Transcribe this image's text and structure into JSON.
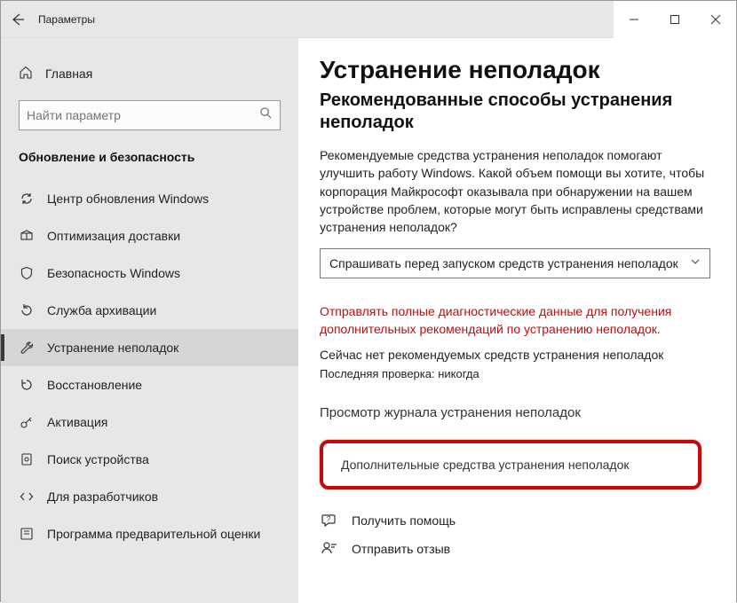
{
  "titlebar": {
    "title": "Параметры"
  },
  "sidebar": {
    "home": "Главная",
    "search_placeholder": "Найти параметр",
    "section": "Обновление и безопасность",
    "items": [
      {
        "label": "Центр обновления Windows"
      },
      {
        "label": "Оптимизация доставки"
      },
      {
        "label": "Безопасность Windows"
      },
      {
        "label": "Служба архивации"
      },
      {
        "label": "Устранение неполадок"
      },
      {
        "label": "Восстановление"
      },
      {
        "label": "Активация"
      },
      {
        "label": "Поиск устройства"
      },
      {
        "label": "Для разработчиков"
      },
      {
        "label": "Программа предварительной оценки"
      }
    ]
  },
  "main": {
    "h1": "Устранение неполадок",
    "h2": "Рекомендованные способы устранения неполадок",
    "para": "Рекомендуемые средства устранения неполадок помогают улучшить работу Windows. Какой объем помощи вы хотите, чтобы корпорация Майкрософт оказывала при обнаружении на вашем устройстве проблем, которые могут быть исправлены средствами устранения неполадок?",
    "combo": "Спрашивать перед запуском средств устранения неполадок",
    "warn": "Отправлять полные диагностические данные для получения дополнительных рекомендаций по устранению неполадок.",
    "status": "Сейчас нет рекомендуемых средств устранения неполадок",
    "last_check": "Последняя проверка: никогда",
    "history": "Просмотр журнала устранения неполадок",
    "additional": "Дополнительные средства устранения неполадок",
    "help": "Получить помощь",
    "feedback": "Отправить отзыв"
  }
}
